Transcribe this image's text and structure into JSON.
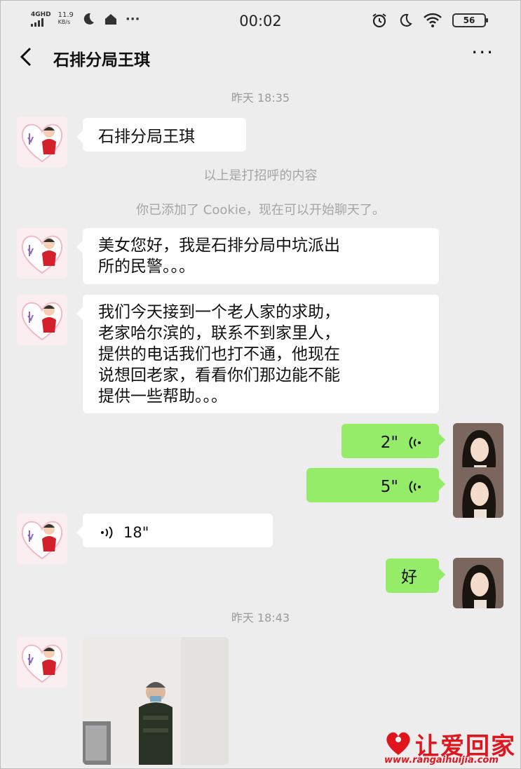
{
  "status_bar": {
    "network": "4GHD",
    "speed_value": "11.9",
    "speed_unit": "KB/s",
    "time": "00:02",
    "battery": "56",
    "more": "···"
  },
  "header": {
    "title": "石排分局王琪",
    "more": "···"
  },
  "messages": {
    "ts1": "昨天 18:35",
    "m1": "石排分局王琪",
    "sys1": "以上是打招呼的内容",
    "sys2": "你已添加了 Cookie，现在可以开始聊天了。",
    "m2_line1": "美女您好，我是石排分局中坑派出",
    "m2_line2": "所的民警。。。",
    "m3_line1": "我们今天接到一个老人家的求助，",
    "m3_line2": "老家哈尔滨的，联系不到家里人，",
    "m3_line3": "提供的电话我们也打不通，他现在",
    "m3_line4": "说想回老家，看看你们那边能不能",
    "m3_line5": "提供一些帮助。。。",
    "v1": "2\"",
    "v2": "5\"",
    "v3": "18\"",
    "m4": "好",
    "ts2": "昨天 18:43"
  },
  "watermark": {
    "text": "让爱回家",
    "url": "www.rangaihuijia.com"
  },
  "colors": {
    "background": "#ededed",
    "outgoing_bubble": "#95ec69",
    "incoming_bubble": "#ffffff",
    "brand_red": "#e0161e"
  }
}
